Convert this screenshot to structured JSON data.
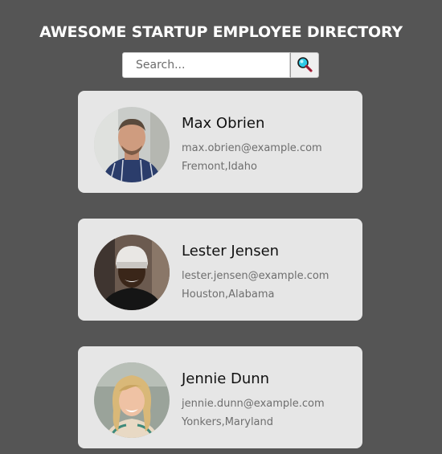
{
  "header": {
    "title": "AWESOME STARTUP EMPLOYEE DIRECTORY"
  },
  "search": {
    "placeholder": "Search...",
    "value": "",
    "button_icon": "magnifier-icon"
  },
  "employees": [
    {
      "name": "Max Obrien",
      "email": "max.obrien@example.com",
      "location": "Fremont,Idaho"
    },
    {
      "name": "Lester Jensen",
      "email": "lester.jensen@example.com",
      "location": "Houston,Alabama"
    },
    {
      "name": "Jennie Dunn",
      "email": "jennie.dunn@example.com",
      "location": "Yonkers,Maryland"
    }
  ],
  "colors": {
    "background": "#555555",
    "card": "#e6e6e6",
    "title": "#ffffff",
    "magnifier_lens": "#2ec9e6"
  }
}
